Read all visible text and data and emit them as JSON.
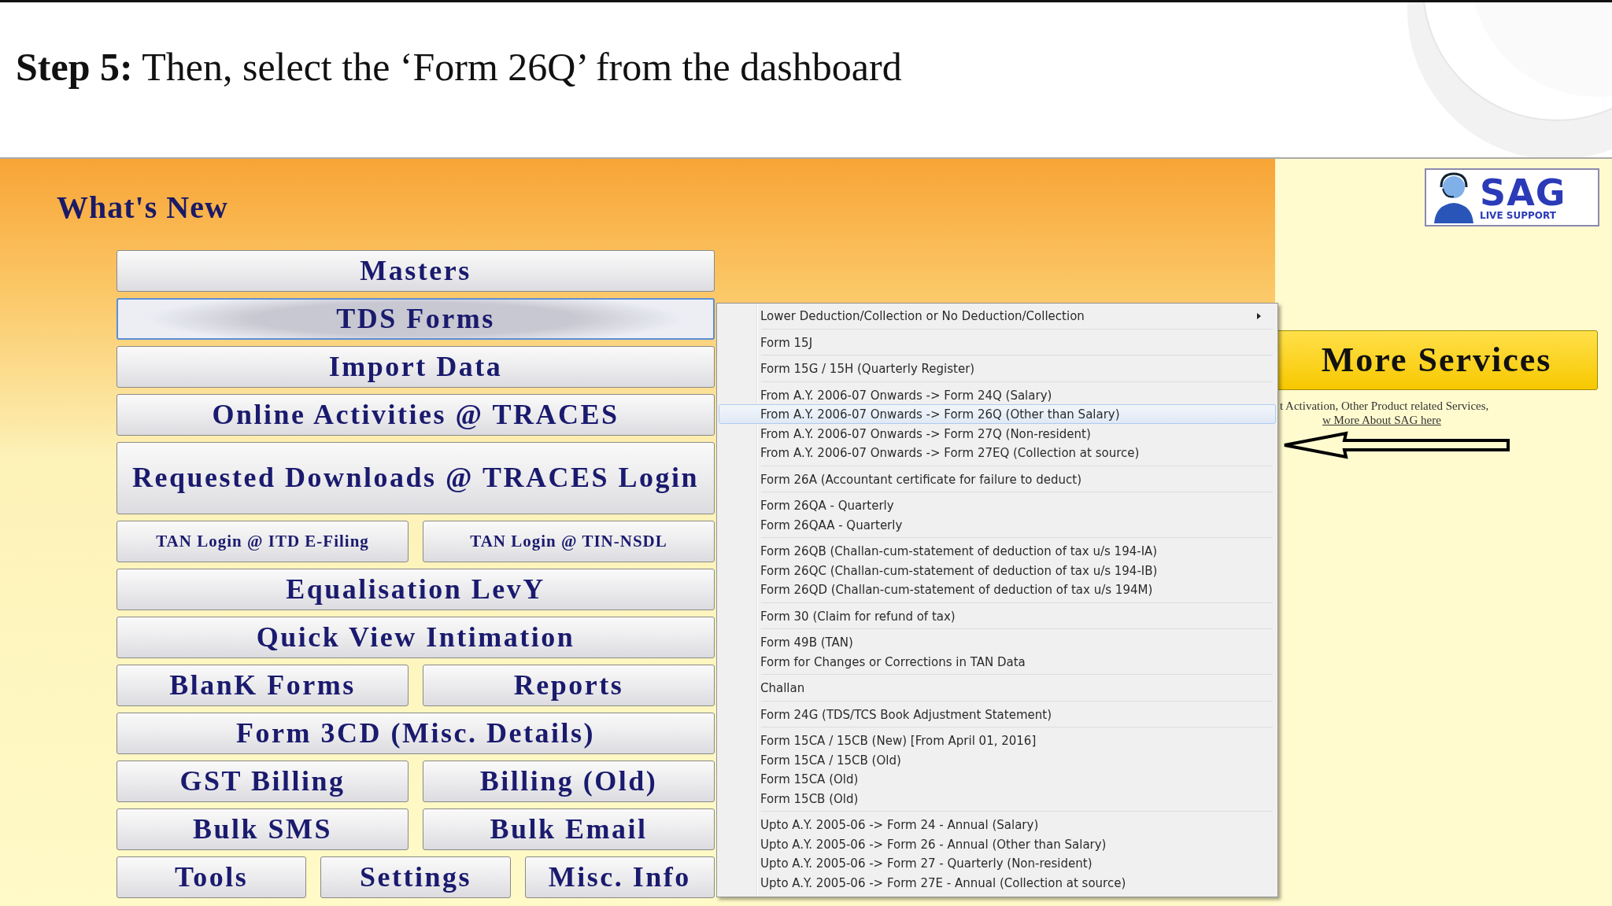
{
  "slide_heading": "**Step 5:** Then, select the ‘Form 26Q’ from the dashboard",
  "panel_title": "What's New",
  "button_rows": [
    [
      {
        "label": "Masters",
        "selected": false
      }
    ],
    [
      {
        "label": "TDS Forms",
        "selected": true
      }
    ],
    [
      {
        "label": "Import Data",
        "selected": false
      }
    ],
    [
      {
        "label": "Online Activities @ TRACES",
        "selected": false
      }
    ],
    [
      {
        "label": "Requested Downloads @ TRACES Login",
        "selected": false
      }
    ],
    [
      {
        "label": "TAN Login @ ITD E-Filing",
        "selected": false,
        "kind": "small"
      },
      {
        "label": "TAN Login @ TIN-NSDL",
        "selected": false,
        "kind": "small"
      }
    ],
    [
      {
        "label": "Equalisation LevY",
        "selected": false
      }
    ],
    [
      {
        "label": "Quick View Intimation",
        "selected": false
      }
    ],
    [
      {
        "label": "BlanK Forms",
        "selected": false
      },
      {
        "label": "Reports",
        "selected": false
      }
    ],
    [
      {
        "label": "Form 3CD (Misc. Details)",
        "selected": false
      }
    ],
    [
      {
        "label": "GST Billing",
        "selected": false
      },
      {
        "label": "Billing (Old)",
        "selected": false
      }
    ],
    [
      {
        "label": "Bulk SMS",
        "selected": false
      },
      {
        "label": "Bulk Email",
        "selected": false
      }
    ],
    [
      {
        "label": "Tools",
        "selected": false
      },
      {
        "label": "Settings",
        "selected": false
      },
      {
        "label": "Misc. Info",
        "selected": false
      }
    ]
  ],
  "menu": {
    "groups": [
      {
        "items": [
          {
            "label": "Lower Deduction/Collection or No Deduction/Collection",
            "selected": false,
            "has_submenu": true
          }
        ]
      },
      {
        "items": [
          {
            "label": "Form 15J",
            "selected": false,
            "has_submenu": false
          }
        ]
      },
      {
        "items": [
          {
            "label": "Form 15G / 15H (Quarterly Register)",
            "selected": false,
            "has_submenu": false
          }
        ]
      },
      {
        "items": [
          {
            "label": "From A.Y. 2006-07 Onwards -> Form 24Q (Salary)",
            "selected": false,
            "has_submenu": false
          },
          {
            "label": "From A.Y. 2006-07 Onwards -> Form 26Q (Other than Salary)",
            "selected": true,
            "has_submenu": false
          },
          {
            "label": "From A.Y. 2006-07 Onwards -> Form 27Q (Non-resident)",
            "selected": false,
            "has_submenu": false
          },
          {
            "label": "From A.Y. 2006-07 Onwards -> Form 27EQ (Collection at source)",
            "selected": false,
            "has_submenu": false
          }
        ]
      },
      {
        "items": [
          {
            "label": "Form 26A (Accountant certificate for failure to deduct)",
            "selected": false,
            "has_submenu": false
          }
        ]
      },
      {
        "items": [
          {
            "label": "Form 26QA - Quarterly",
            "selected": false,
            "has_submenu": false
          },
          {
            "label": "Form 26QAA - Quarterly",
            "selected": false,
            "has_submenu": false
          }
        ]
      },
      {
        "items": [
          {
            "label": "Form 26QB (Challan-cum-statement of deduction of tax u/s 194-IA)",
            "selected": false,
            "has_submenu": false
          },
          {
            "label": "Form 26QC (Challan-cum-statement of deduction of tax u/s 194-IB)",
            "selected": false,
            "has_submenu": false
          },
          {
            "label": "Form 26QD (Challan-cum-statement of deduction of tax u/s 194M)",
            "selected": false,
            "has_submenu": false
          }
        ]
      },
      {
        "items": [
          {
            "label": "Form 30 (Claim for refund of tax)",
            "selected": false,
            "has_submenu": false
          }
        ]
      },
      {
        "items": [
          {
            "label": "Form 49B (TAN)",
            "selected": false,
            "has_submenu": false
          },
          {
            "label": "Form for Changes or Corrections in TAN Data",
            "selected": false,
            "has_submenu": false
          }
        ]
      },
      {
        "items": [
          {
            "label": "Challan",
            "selected": false,
            "has_submenu": false
          }
        ]
      },
      {
        "items": [
          {
            "label": "Form 24G (TDS/TCS Book Adjustment Statement)",
            "selected": false,
            "has_submenu": false
          }
        ]
      },
      {
        "items": [
          {
            "label": "Form 15CA / 15CB (New) [From April 01, 2016]",
            "selected": false,
            "has_submenu": false
          },
          {
            "label": "Form 15CA / 15CB (Old)",
            "selected": false,
            "has_submenu": false
          },
          {
            "label": "Form 15CA (Old)",
            "selected": false,
            "has_submenu": false
          },
          {
            "label": "Form 15CB (Old)",
            "selected": false,
            "has_submenu": false
          }
        ]
      },
      {
        "items": [
          {
            "label": "Upto A.Y. 2005-06 -> Form 24 - Annual (Salary)",
            "selected": false,
            "has_submenu": false
          },
          {
            "label": "Upto A.Y. 2005-06 -> Form 26 - Annual (Other than Salary)",
            "selected": false,
            "has_submenu": false
          },
          {
            "label": "Upto A.Y. 2005-06 -> Form 27 - Quarterly (Non-resident)",
            "selected": false,
            "has_submenu": false
          },
          {
            "label": "Upto A.Y. 2005-06 -> Form 27E - Annual (Collection at source)",
            "selected": false,
            "has_submenu": false
          }
        ]
      }
    ]
  },
  "logo": {
    "title": "SAG",
    "subtitle": "LIVE SUPPORT"
  },
  "more_services": {
    "label": "More Services",
    "lines": [
      "t Activation, Other Product related Services,",
      "w More About SAG here"
    ]
  }
}
